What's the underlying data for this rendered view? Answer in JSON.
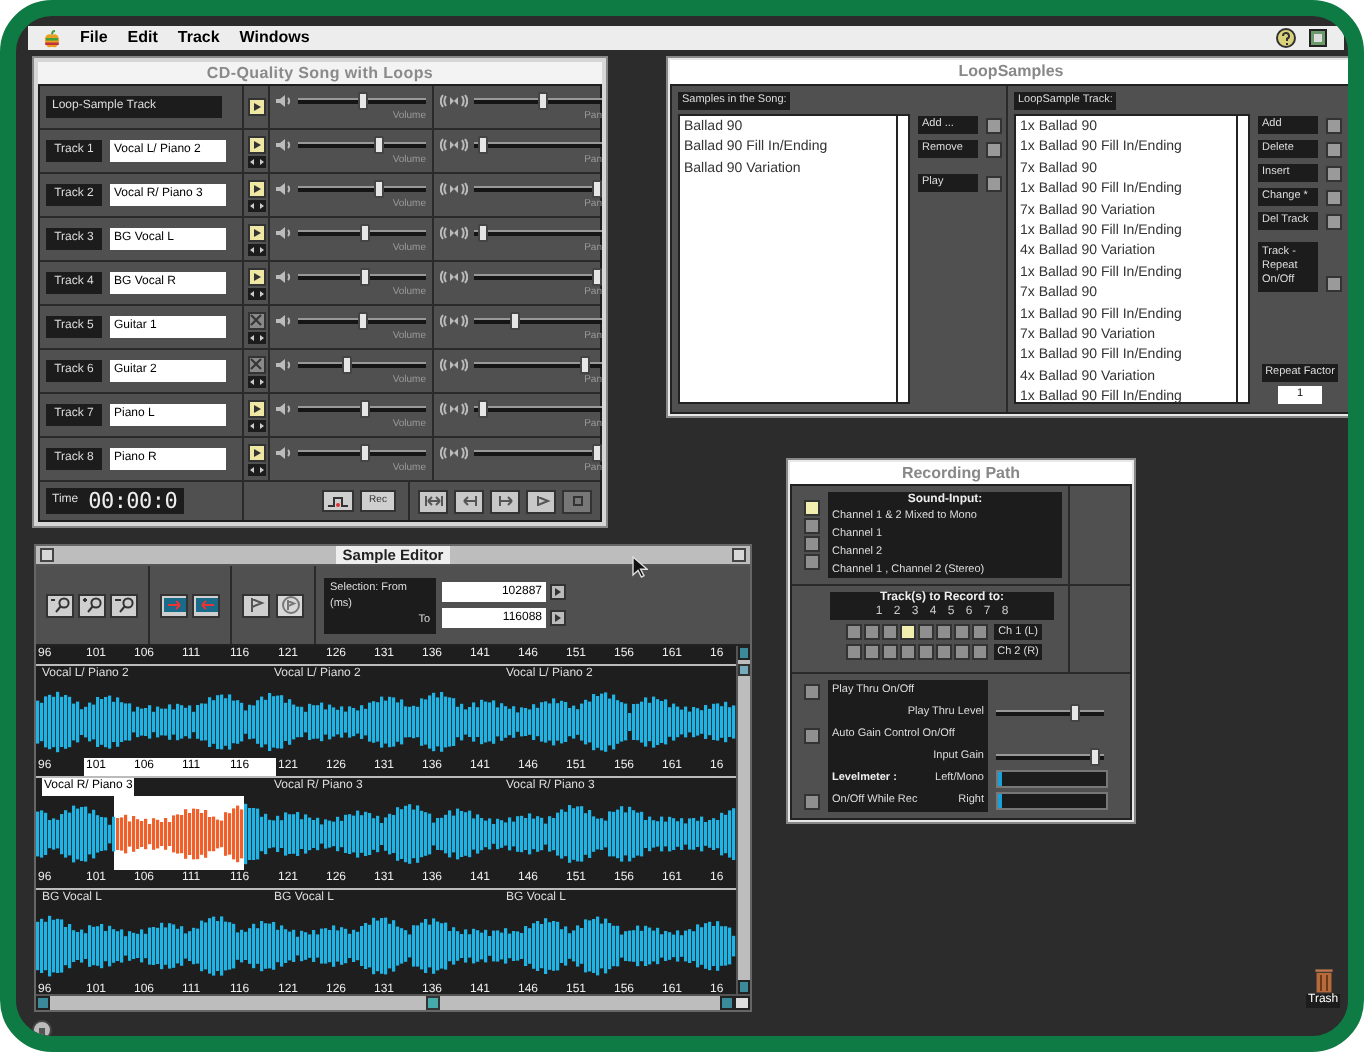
{
  "menu_bar": {
    "items": [
      "File",
      "Edit",
      "Track",
      "Windows"
    ]
  },
  "mixer": {
    "title": "CD-Quality Song with Loops",
    "rows": [
      {
        "kind": "loop",
        "label": "Loop-Sample Track",
        "playing": true,
        "volume": {
          "level": 0.5,
          "caption": "Volume"
        },
        "pan": {
          "level": 0.55,
          "caption": "Pan"
        }
      },
      {
        "kind": "track",
        "label": "Track 1",
        "name": "Vocal L/ Piano 2",
        "playing": true,
        "volume": {
          "level": 0.65,
          "caption": "Volume"
        },
        "pan": {
          "level": 0.03,
          "caption": "Pan"
        }
      },
      {
        "kind": "track",
        "label": "Track 2",
        "name": "Vocal R/ Piano 3",
        "playing": true,
        "volume": {
          "level": 0.65,
          "caption": "Volume"
        },
        "pan": {
          "level": 1,
          "caption": "Pan"
        }
      },
      {
        "kind": "track",
        "label": "Track 3",
        "name": "BG Vocal L",
        "playing": true,
        "volume": {
          "level": 0.52,
          "caption": "Volume"
        },
        "pan": {
          "level": 0.03,
          "caption": "Pan"
        }
      },
      {
        "kind": "track",
        "label": "Track 4",
        "name": "BG Vocal R",
        "playing": true,
        "volume": {
          "level": 0.52,
          "caption": "Volume"
        },
        "pan": {
          "level": 1,
          "caption": "Pan"
        }
      },
      {
        "kind": "track",
        "label": "Track 5",
        "name": "Guitar 1",
        "playing": false,
        "volume": {
          "level": 0.5,
          "caption": "Volume"
        },
        "pan": {
          "level": 0.3,
          "caption": "Pan"
        }
      },
      {
        "kind": "track",
        "label": "Track 6",
        "name": "Guitar 2",
        "playing": false,
        "volume": {
          "level": 0.38,
          "caption": "Volume"
        },
        "pan": {
          "level": 0.9,
          "caption": "Pan"
        }
      },
      {
        "kind": "track",
        "label": "Track 7",
        "name": "Piano L",
        "playing": true,
        "volume": {
          "level": 0.53,
          "caption": "Volume"
        },
        "pan": {
          "level": 0.03,
          "caption": "Pan"
        }
      },
      {
        "kind": "track",
        "label": "Track 8",
        "name": "Piano R",
        "playing": true,
        "volume": {
          "level": 0.53,
          "caption": "Volume"
        },
        "pan": {
          "level": 1,
          "caption": "Pan"
        }
      }
    ],
    "time_label": "Time",
    "time": "00:00:0",
    "rec_button": "Rec"
  },
  "loop_samples": {
    "title": "LoopSamples",
    "song_header": "Samples in the Song:",
    "song_samples": [
      "Ballad 90",
      "Ballad 90 Fill In/Ending",
      "Ballad 90 Variation"
    ],
    "song_buttons": [
      "Add ...",
      "Remove",
      "Play"
    ],
    "track_header": "LoopSample Track:",
    "track_items": [
      "1x Ballad 90",
      "1x Ballad 90 Fill In/Ending",
      "7x Ballad 90",
      "1x Ballad 90 Fill In/Ending",
      "7x Ballad 90 Variation",
      "1x Ballad 90 Fill In/Ending",
      "4x Ballad 90 Variation",
      "1x Ballad 90 Fill In/Ending",
      "7x Ballad 90",
      "1x Ballad 90 Fill In/Ending",
      "7x Ballad 90 Variation",
      "1x Ballad 90 Fill In/Ending",
      "4x Ballad 90 Variation",
      "1x Ballad 90 Fill In/Ending"
    ],
    "track_buttons": [
      "Add",
      "Delete",
      "Insert",
      "Change *",
      "Del Track"
    ],
    "repeat_toggle": "Track -\nRepeat\nOn/Off",
    "repeat_factor_label": "Repeat Factor",
    "repeat_factor": "1"
  },
  "recording_path": {
    "title": "Recording Path",
    "input_header": "Sound-Input:",
    "inputs": [
      {
        "label": "Channel 1 & 2 Mixed to Mono",
        "selected": true
      },
      {
        "label": "Channel 1",
        "selected": false
      },
      {
        "label": "Channel 2",
        "selected": false
      },
      {
        "label": "Channel 1 , Channel 2 (Stereo)",
        "selected": false
      }
    ],
    "tracks_header": "Track(s) to Record to:",
    "track_numbers": [
      "1",
      "2",
      "3",
      "4",
      "5",
      "6",
      "7",
      "8"
    ],
    "channels": [
      {
        "label": "Ch 1 (L)",
        "targets": [
          {
            "selected": false
          },
          {
            "selected": false
          },
          {
            "selected": false
          },
          {
            "selected": true
          },
          {
            "selected": false
          },
          {
            "selected": false
          },
          {
            "selected": false
          },
          {
            "selected": false
          }
        ]
      },
      {
        "label": "Ch 2 (R)",
        "targets": [
          {
            "selected": false
          },
          {
            "selected": false
          },
          {
            "selected": false
          },
          {
            "selected": false
          },
          {
            "selected": false
          },
          {
            "selected": false
          },
          {
            "selected": false
          },
          {
            "selected": false
          }
        ]
      }
    ],
    "options": [
      {
        "kind": "toggle",
        "label": "Play Thru On/Off",
        "checked": false
      },
      {
        "kind": "slider",
        "label": "Play Thru Level",
        "level": 0.75
      },
      {
        "kind": "toggle",
        "label": "Auto Gain Control On/Off",
        "checked": false
      },
      {
        "kind": "slider",
        "label": "Input Gain",
        "level": 0.95
      }
    ],
    "levelmeter": {
      "label": "Levelmeter :",
      "meters": [
        {
          "label": "Left/Mono",
          "level": 0.03
        },
        {
          "label": "Right",
          "level": 0.03
        }
      ],
      "toggle_label": "On/Off While Rec",
      "checked": false
    }
  },
  "sample_editor": {
    "title": "Sample Editor",
    "from_label": "Selection: From",
    "unit": "(ms)",
    "to_label": "To",
    "from": "102887",
    "to": "116088",
    "rulers": [
      {
        "ticks": [
          "96",
          "101",
          "106",
          "111",
          "116",
          "121",
          "126",
          "131",
          "136",
          "141",
          "146",
          "151",
          "156",
          "161",
          "16"
        ]
      },
      {
        "ticks": [
          "96",
          "101",
          "106",
          "111",
          "116",
          "121",
          "126",
          "131",
          "136",
          "141",
          "146",
          "151",
          "156",
          "161",
          "16"
        ]
      },
      {
        "ticks": [
          "96",
          "101",
          "106",
          "111",
          "116",
          "121",
          "126",
          "131",
          "136",
          "141",
          "146",
          "151",
          "156",
          "161",
          "16"
        ]
      },
      {
        "ticks": [
          "96",
          "101",
          "106",
          "111",
          "116",
          "121",
          "126",
          "131",
          "136",
          "141",
          "146",
          "151",
          "156",
          "161",
          "16"
        ]
      }
    ],
    "tracks": [
      {
        "labels": [
          "Vocal L/ Piano 2",
          "Vocal L/ Piano 2",
          "Vocal L/ Piano 2"
        ],
        "selected": false
      },
      {
        "labels": [
          "Vocal R/ Piano 3",
          "Vocal R/ Piano 3",
          "Vocal R/ Piano 3"
        ],
        "selected": true
      },
      {
        "labels": [
          "BG Vocal L",
          "BG Vocal L",
          "BG Vocal L"
        ],
        "selected": false
      }
    ]
  },
  "trash": {
    "label": "Trash"
  }
}
